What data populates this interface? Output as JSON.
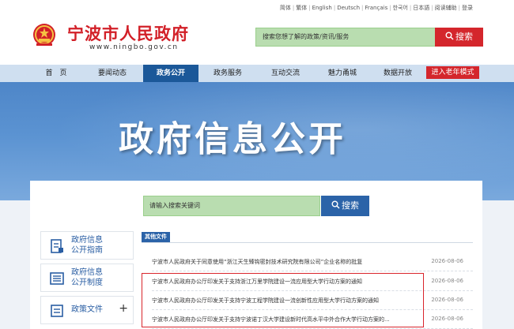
{
  "header": {
    "languages": [
      "简体",
      "繁体",
      "English",
      "Deutsch",
      "Français",
      "한국어",
      "日本語",
      "阅读辅助",
      "登录"
    ],
    "site_title": "宁波市人民政府",
    "site_url": "www.ningbo.gov.cn",
    "search_placeholder": "搜索您想了解的政策/资讯/服务",
    "search_button": "搜索"
  },
  "nav": {
    "items": [
      "首　页",
      "要闻动态",
      "政务公开",
      "政务服务",
      "互动交流",
      "魅力甬城",
      "数据开放"
    ],
    "active_index": 2,
    "elder_mode": "进入老年模式"
  },
  "banner": {
    "title": "政府信息公开"
  },
  "content": {
    "search_placeholder": "请输入搜索关键词",
    "search_button": "搜索",
    "side_menu": [
      {
        "line1": "政府信息",
        "line2": "公开指南",
        "icon": "guide-icon"
      },
      {
        "line1": "政府信息",
        "line2": "公开制度",
        "icon": "system-icon"
      },
      {
        "line1": "政策文件",
        "line2": "",
        "icon": "policy-icon",
        "expand": "+"
      }
    ],
    "list_tag": "其他文件",
    "list": [
      {
        "title": "宁波市人民政府关于同意使用“浙江天生臻钩密封技术研究院有限公司”企业名称的批复",
        "date": "2026-08-06"
      },
      {
        "title": "宁波市人民政府办公厅印发关于支持浙江万里学院建设一流应用型大学行动方案的通知",
        "date": "2026-08-06"
      },
      {
        "title": "宁波市人民政府办公厅印发关于支持宁波工程学院建设一流创新性应用型大学行动方案的通知",
        "date": "2026-08-06"
      },
      {
        "title": "宁波市人民政府办公厅印发关于支持宁波诺丁汉大学建设新时代高水平中外合作大学行动方案的...",
        "date": "2026-08-06"
      }
    ]
  },
  "colors": {
    "brand_red": "#d22028",
    "nav_active": "#1b5899",
    "search_green": "#b9ddb0",
    "link_blue": "#2a5ea3"
  }
}
